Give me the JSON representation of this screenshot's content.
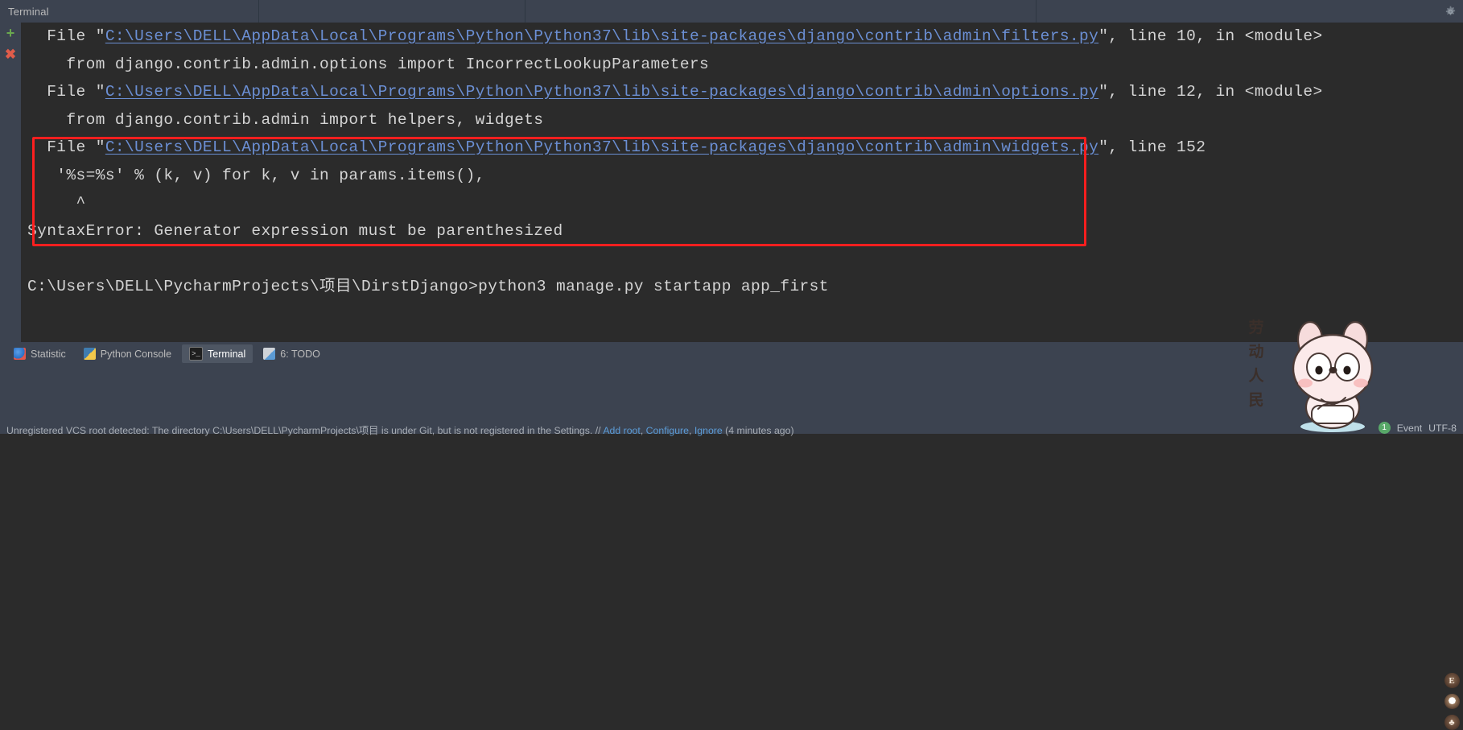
{
  "window": {
    "top_tab_label": "Terminal",
    "gear_icon": "gear-icon"
  },
  "gutter": {
    "new_session_label": "+",
    "close_session_label": "✖"
  },
  "terminal": {
    "lines": [
      {
        "id": "trace-file-1",
        "segments": [
          {
            "kind": "text",
            "text": "  File ʺ"
          },
          {
            "kind": "link",
            "text": "C:\\Users\\DELL\\AppData\\Local\\Programs\\Python\\Python37\\lib\\site-packages\\django\\contrib\\admin\\filters.py"
          },
          {
            "kind": "text",
            "text": "ʺ, line 10, in <module>"
          }
        ]
      },
      {
        "id": "trace-code-1",
        "segments": [
          {
            "kind": "text",
            "text": "    from django.contrib.admin.options import IncorrectLookupParameters"
          }
        ]
      },
      {
        "id": "trace-file-2",
        "segments": [
          {
            "kind": "text",
            "text": "  File ʺ"
          },
          {
            "kind": "link",
            "text": "C:\\Users\\DELL\\AppData\\Local\\Programs\\Python\\Python37\\lib\\site-packages\\django\\contrib\\admin\\options.py"
          },
          {
            "kind": "text",
            "text": "ʺ, line 12, in <module>"
          }
        ]
      },
      {
        "id": "trace-code-2",
        "segments": [
          {
            "kind": "text",
            "text": "    from django.contrib.admin import helpers, widgets"
          }
        ]
      },
      {
        "id": "trace-file-3",
        "segments": [
          {
            "kind": "text",
            "text": "  File ʺ"
          },
          {
            "kind": "link",
            "text": "C:\\Users\\DELL\\AppData\\Local\\Programs\\Python\\Python37\\lib\\site-packages\\django\\contrib\\admin\\widgets.py"
          },
          {
            "kind": "text",
            "text": "ʺ, line 152"
          }
        ]
      },
      {
        "id": "trace-code-3",
        "segments": [
          {
            "kind": "text",
            "text": "   '%s=%s' % (k, v) for k, v in params.items(),"
          }
        ]
      },
      {
        "id": "trace-caret",
        "segments": [
          {
            "kind": "text",
            "text": "     ^"
          }
        ]
      },
      {
        "id": "error-line",
        "segments": [
          {
            "kind": "text",
            "text": "SyntaxError: Generator expression must be parenthesized"
          }
        ]
      },
      {
        "id": "blank-1",
        "segments": [
          {
            "kind": "text",
            "text": ""
          }
        ]
      },
      {
        "id": "prompt-line",
        "segments": [
          {
            "kind": "text",
            "text": "C:\\Users\\DELL\\PycharmProjects\\项目\\DirstDjango>python3 manage.py startapp app_first"
          }
        ]
      }
    ],
    "annotation": {
      "name": "red-highlight-box",
      "color": "#fc1f1f"
    }
  },
  "tool_window_bar": {
    "items": [
      {
        "label": "Statistic",
        "icon": "statistic-icon",
        "icon_class": "ico-statistic",
        "active": false
      },
      {
        "label": "Python Console",
        "icon": "python-console-icon",
        "icon_class": "ico-pyconsole",
        "active": false
      },
      {
        "label": "Terminal",
        "icon": "terminal-icon",
        "icon_class": "ico-terminal",
        "active": true,
        "glyph": ">_"
      },
      {
        "label": "6: TODO",
        "icon": "todo-icon",
        "icon_class": "ico-todo",
        "active": false
      }
    ]
  },
  "status_bar": {
    "message_prefix": "Unregistered VCS root detected: The directory C:\\Users\\DELL\\PycharmProjects\\项目 is under Git, but is not registered in the Settings. // ",
    "link_add_root": "Add root",
    "separator_1": ", ",
    "link_configure": "Configure",
    "separator_2": ", ",
    "link_ignore": "Ignore",
    "message_suffix": " (4 minutes ago)",
    "event_count": "1",
    "event_label": "Event",
    "encoding_label": "UTF-8"
  },
  "right_icons": [
    {
      "name": "e-badge-icon",
      "glyph": "E"
    },
    {
      "name": "dot-badge-icon",
      "glyph": ""
    },
    {
      "name": "paw-badge-icon",
      "glyph": "♣"
    }
  ],
  "mascot": {
    "name": "rabbit-mascot",
    "caption": "劳动人民"
  }
}
